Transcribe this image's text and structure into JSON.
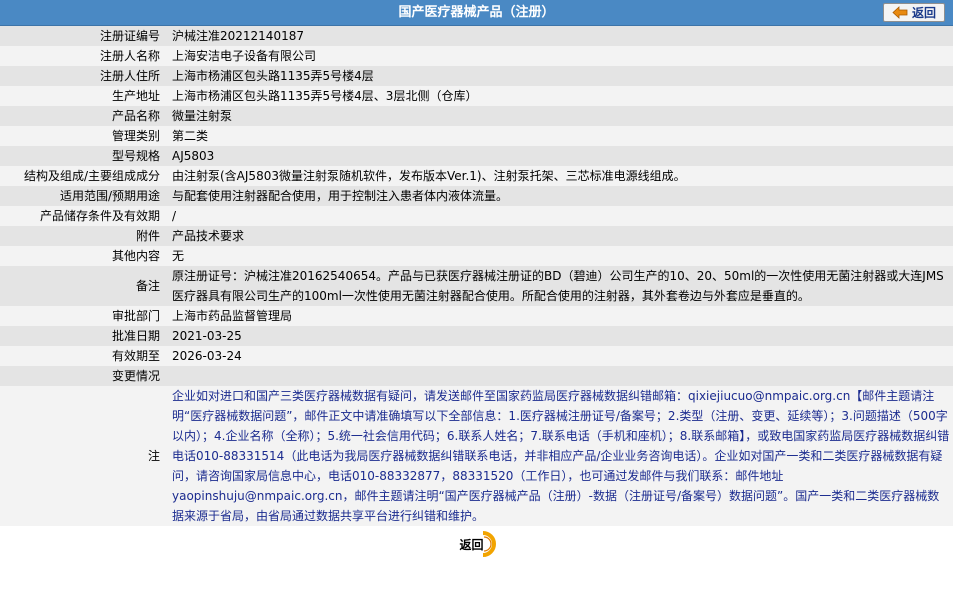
{
  "header": {
    "title": "国产医疗器械产品（注册）",
    "back_label": "返回"
  },
  "rows": [
    {
      "label": "注册证编号",
      "value": "沪械注准20212140187"
    },
    {
      "label": "注册人名称",
      "value": "上海安洁电子设备有限公司"
    },
    {
      "label": "注册人住所",
      "value": "上海市杨浦区包头路1135弄5号楼4层"
    },
    {
      "label": "生产地址",
      "value": "上海市杨浦区包头路1135弄5号楼4层、3层北侧（仓库）"
    },
    {
      "label": "产品名称",
      "value": "微量注射泵"
    },
    {
      "label": "管理类别",
      "value": "第二类"
    },
    {
      "label": "型号规格",
      "value": "AJ5803"
    },
    {
      "label": "结构及组成/主要组成成分",
      "value": "由注射泵(含AJ5803微量注射泵随机软件，发布版本Ver.1)、注射泵托架、三芯标准电源线组成。"
    },
    {
      "label": "适用范围/预期用途",
      "value": "与配套使用注射器配合使用，用于控制注入患者体内液体流量。"
    },
    {
      "label": "产品储存条件及有效期",
      "value": "/"
    },
    {
      "label": "附件",
      "value": "产品技术要求"
    },
    {
      "label": "其他内容",
      "value": "无"
    },
    {
      "label": "备注",
      "value": "原注册证号：沪械注准20162540654。产品与已获医疗器械注册证的BD（碧迪）公司生产的10、20、50ml的一次性使用无菌注射器或大连JMS医疗器具有限公司生产的100ml一次性使用无菌注射器配合使用。所配合使用的注射器，其外套卷边与外套应是垂直的。"
    },
    {
      "label": "审批部门",
      "value": "上海市药品监督管理局"
    },
    {
      "label": "批准日期",
      "value": "2021-03-25"
    },
    {
      "label": "有效期至",
      "value": "2026-03-24"
    },
    {
      "label": "变更情况",
      "value": ""
    }
  ],
  "note": {
    "label": "注",
    "text": "企业如对进口和国产三类医疗器械数据有疑问，请发送邮件至国家药监局医疗器械数据纠错邮箱：qixiejiucuo@nmpaic.org.cn【邮件主题请注明“医疗器械数据问题”，邮件正文中请准确填写以下全部信息：1.医疗器械注册证号/备案号；2.类型（注册、变更、延续等）；3.问题描述（500字以内）；4.企业名称（全称）；5.统一社会信用代码；6.联系人姓名；7.联系电话（手机和座机）；8.联系邮箱】，或致电国家药监局医疗器械数据纠错电话010-88331514（此电话为我局医疗器械数据纠错联系电话，并非相应产品/企业业务咨询电话）。企业如对国产一类和二类医疗器械数据有疑问，请咨询国家局信息中心，电话010-88332877，88331520（工作日），也可通过发邮件与我们联系：邮件地址yaopinshuju@nmpaic.org.cn，邮件主题请注明“国产医疗器械产品（注册）-数据（注册证号/备案号）数据问题”。国产一类和二类医疗器械数据来源于省局，由省局通过数据共享平台进行纠错和维护。"
  },
  "footer": {
    "back_label": "返回"
  },
  "colors": {
    "header_bg": "#4a89c4",
    "row_shade": "#e4e4e4",
    "row_plain": "#f3f3f3",
    "note_text": "#1b2b8f",
    "back_ring": "#f2a400"
  }
}
